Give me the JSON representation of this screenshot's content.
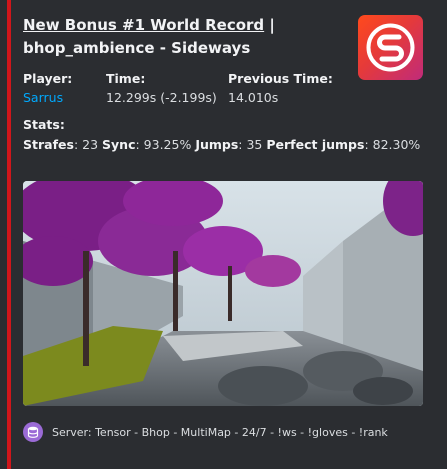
{
  "embed": {
    "title_link": "New Bonus #1 World Record",
    "title_rest": " | bhop_ambience - Sideways",
    "fields": [
      {
        "name": "Player:",
        "value": "Sarrus"
      },
      {
        "name": "Time:",
        "value": "12.299s (-2.199s)"
      },
      {
        "name": "Previous Time:",
        "value": "14.010s"
      }
    ],
    "stats_label": "Stats:",
    "stats": [
      {
        "label": "Strafes",
        "value": "23"
      },
      {
        "label": "Sync",
        "value": "93.25%"
      },
      {
        "label": "Jumps",
        "value": "35"
      },
      {
        "label": "Perfect jumps",
        "value": "82.30%"
      }
    ],
    "footer_text": "Server: Tensor - Bhop - MultiMap - 24/7 - !ws - !gloves - !rank",
    "thumbnail_icon": "server-logo-icon",
    "footer_icon": "database-icon",
    "accent_color": "#d0161b"
  }
}
